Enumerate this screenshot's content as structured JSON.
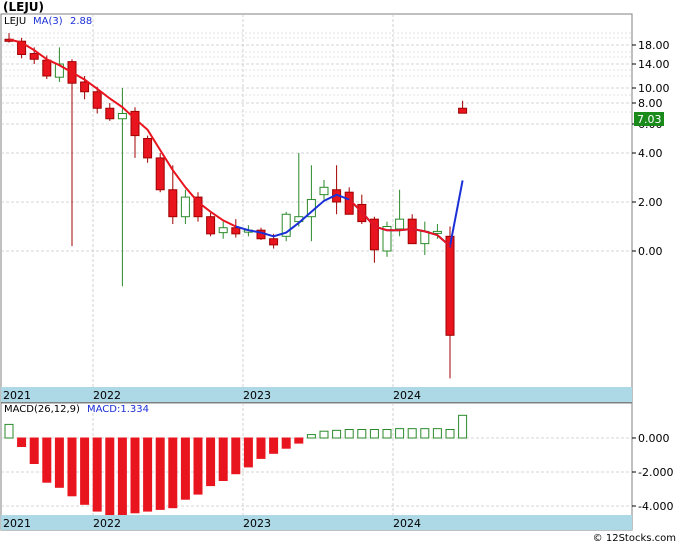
{
  "title": "(LEJU)",
  "footer": "© 12Stocks.com",
  "colors": {
    "up": "#2a8a2a",
    "down": "#e8141e",
    "ma_down": "#e8141e",
    "ma_up": "#1a2fd6",
    "macd_up": "#2a8a2a",
    "macd_down": "#e8141e",
    "axis_band": "#add8e6",
    "grid": "#c8c8c8",
    "last_price_box": "#1a8a1a"
  },
  "chart_data": [
    {
      "type": "candlestick",
      "legend": {
        "ticker": "LEJU",
        "ma_label": "MA(3)",
        "ma_value": "2.88"
      },
      "last_price": "7.03",
      "y_tick_labels": [
        "18.00",
        "14.00",
        "10.00",
        "8.00",
        "6.00",
        "4.00",
        "2.00",
        "0.00"
      ],
      "x_tick_labels": [
        "2021",
        "2022",
        "2023",
        "2024"
      ],
      "candles": [
        {
          "o": 19.2,
          "h": 20.5,
          "l": 18.5,
          "c": 18.8
        },
        {
          "o": 18.8,
          "h": 19.5,
          "l": 15.2,
          "c": 16.0
        },
        {
          "o": 16.2,
          "h": 17.5,
          "l": 14.0,
          "c": 15.0
        },
        {
          "o": 14.8,
          "h": 15.8,
          "l": 11.5,
          "c": 12.0
        },
        {
          "o": 11.8,
          "h": 17.5,
          "l": 11.0,
          "c": 14.0
        },
        {
          "o": 14.5,
          "h": 15.0,
          "l": 0.2,
          "c": 10.8
        },
        {
          "o": 11.0,
          "h": 12.0,
          "l": 8.5,
          "c": 9.5
        },
        {
          "o": 9.5,
          "h": 10.2,
          "l": 7.0,
          "c": 7.5
        },
        {
          "o": 7.5,
          "h": 8.0,
          "l": 6.3,
          "c": 6.5
        },
        {
          "o": 6.5,
          "h": 10.0,
          "l": -1.8,
          "c": 7.0
        },
        {
          "o": 7.2,
          "h": 7.6,
          "l": 3.8,
          "c": 5.2
        },
        {
          "o": 5.0,
          "h": 5.2,
          "l": 3.6,
          "c": 3.8
        },
        {
          "o": 3.8,
          "h": 4.0,
          "l": 2.4,
          "c": 2.5
        },
        {
          "o": 2.5,
          "h": 3.5,
          "l": 1.1,
          "c": 1.4
        },
        {
          "o": 1.4,
          "h": 2.5,
          "l": 1.1,
          "c": 2.2
        },
        {
          "o": 2.2,
          "h": 2.4,
          "l": 1.2,
          "c": 1.4
        },
        {
          "o": 1.4,
          "h": 1.6,
          "l": 0.6,
          "c": 0.7
        },
        {
          "o": 0.75,
          "h": 1.2,
          "l": 0.5,
          "c": 0.95
        },
        {
          "o": 0.95,
          "h": 1.3,
          "l": 0.55,
          "c": 0.7
        },
        {
          "o": 0.85,
          "h": 1.05,
          "l": 0.6,
          "c": 0.85
        },
        {
          "o": 0.85,
          "h": 0.95,
          "l": 0.45,
          "c": 0.5
        },
        {
          "o": 0.5,
          "h": 0.7,
          "l": 0.1,
          "c": 0.25
        },
        {
          "o": 0.6,
          "h": 1.6,
          "l": 0.4,
          "c": 1.5
        },
        {
          "o": 1.2,
          "h": 4.0,
          "l": 1.0,
          "c": 1.4
        },
        {
          "o": 1.4,
          "h": 3.5,
          "l": 0.4,
          "c": 2.1
        },
        {
          "o": 2.3,
          "h": 2.9,
          "l": 2.1,
          "c": 2.6
        },
        {
          "o": 2.5,
          "h": 3.5,
          "l": 1.5,
          "c": 2.0
        },
        {
          "o": 2.4,
          "h": 2.6,
          "l": 1.5,
          "c": 1.5
        },
        {
          "o": 1.9,
          "h": 2.3,
          "l": 1.1,
          "c": 1.2
        },
        {
          "o": 1.3,
          "h": 1.4,
          "l": -0.6,
          "c": 0.05
        },
        {
          "o": 0.0,
          "h": 1.2,
          "l": -0.3,
          "c": 1.0
        },
        {
          "o": 0.9,
          "h": 2.5,
          "l": 0.6,
          "c": 1.3
        },
        {
          "o": 1.3,
          "h": 1.5,
          "l": 0.3,
          "c": 0.3
        },
        {
          "o": 0.3,
          "h": 1.2,
          "l": -0.2,
          "c": 0.8
        },
        {
          "o": 0.8,
          "h": 1.1,
          "l": 0.5,
          "c": 0.8
        },
        {
          "o": 0.6,
          "h": 1.0,
          "l": -6.5,
          "c": -4.3
        },
        {
          "o": 7.5,
          "h": 8.3,
          "l": 7.1,
          "c": 7.03
        }
      ],
      "ma": [
        19.2,
        18.5,
        16.9,
        15.0,
        13.8,
        12.6,
        11.4,
        9.9,
        8.6,
        7.6,
        6.5,
        5.6,
        4.2,
        3.3,
        2.6,
        2.0,
        1.6,
        1.25,
        1.0,
        0.85,
        0.75,
        0.6,
        0.75,
        1.15,
        1.6,
        2.05,
        2.3,
        2.1,
        1.6,
        1.0,
        0.85,
        0.85,
        0.9,
        0.8,
        0.65,
        0.2,
        2.88
      ],
      "ma_down_until_index": 18,
      "ma_up_from_index": 18
    },
    {
      "type": "bar",
      "legend": {
        "label": "MACD(26,12,9)",
        "value_label": "MACD:1.334"
      },
      "y_tick_labels": [
        "0.000",
        "-2.000",
        "-4.000"
      ],
      "x_tick_labels": [
        "2021",
        "2022",
        "2023",
        "2024"
      ],
      "values": [
        0.8,
        -0.5,
        -1.5,
        -2.6,
        -2.9,
        -3.4,
        -3.9,
        -4.3,
        -4.5,
        -4.5,
        -4.4,
        -4.3,
        -4.2,
        -4.1,
        -3.6,
        -3.3,
        -2.8,
        -2.5,
        -2.1,
        -1.7,
        -1.2,
        -0.9,
        -0.6,
        -0.3,
        0.2,
        0.4,
        0.45,
        0.5,
        0.5,
        0.5,
        0.5,
        0.55,
        0.55,
        0.55,
        0.55,
        0.5,
        1.334
      ]
    }
  ]
}
